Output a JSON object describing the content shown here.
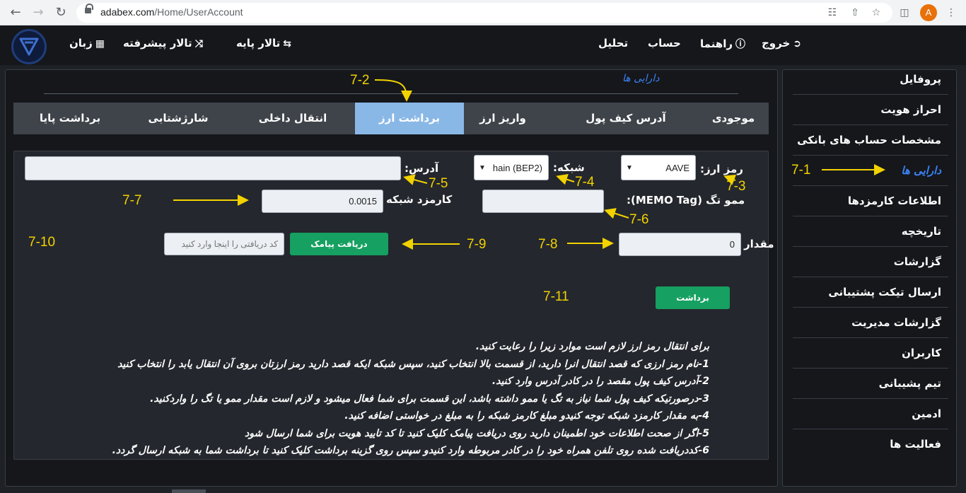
{
  "browser": {
    "url_host": "adabex.com",
    "url_path": "/Home/UserAccount",
    "profile_initial": "A",
    "icons": [
      "back-arrow-icon",
      "forward-arrow-icon",
      "reload-icon",
      "lock-icon",
      "translate-icon",
      "share-icon",
      "star-icon",
      "sidepanel-icon",
      "menu-dots-icon"
    ]
  },
  "topnav": {
    "exit": "خروج",
    "help": "راهنما",
    "account": "حساب",
    "analysis": "تحلیل",
    "basic_hall": "تالار پایه",
    "advanced_hall": "تالار پیشرفته",
    "language": "زبان"
  },
  "sidebar": {
    "items": [
      {
        "label": "پروفایل"
      },
      {
        "label": "احراز هویت"
      },
      {
        "label": "مشخصات حساب های بانکی"
      },
      {
        "label": "دارایی ها"
      },
      {
        "label": "اطلاعات کارمزدها"
      },
      {
        "label": "تاریخچه"
      },
      {
        "label": "گزارشات"
      },
      {
        "label": "ارسال تیکت پشتیبانی"
      },
      {
        "label": "گزارشات مدیریت"
      },
      {
        "label": "کاربران"
      },
      {
        "label": "تیم پشیبانی"
      },
      {
        "label": "ادمین"
      },
      {
        "label": "فعالیت ها"
      }
    ],
    "active": "دارایی ها"
  },
  "main": {
    "title": "دارایی ها",
    "tabs": [
      {
        "label": "موجودی"
      },
      {
        "label": "آدرس کیف پول"
      },
      {
        "label": "واریز ارز"
      },
      {
        "label": "برداشت ارز"
      },
      {
        "label": "انتقال داخلی"
      },
      {
        "label": "شارژشتابی"
      },
      {
        "label": "برداشت پایا"
      }
    ],
    "active_tab": "برداشت ارز"
  },
  "form": {
    "currency_label": "رمز ارز:",
    "currency_value": "AAVE",
    "network_label": "شبکه:",
    "network_value": "hain (BEP2)",
    "address_label": "آدرس:",
    "address_value": "",
    "memo_label": "ممو تگ (MEMO Tag):",
    "memo_value": "",
    "fee_label": "کارمزد شبکه",
    "fee_value": "0.0015",
    "amount_label": "مقدار",
    "amount_value": "0",
    "sms_button": "دریافت پیامک",
    "code_placeholder": "کد دریافتی را اینجا وارد کنید",
    "withdraw_button": "برداشت"
  },
  "annotations": [
    "7-1",
    "7-2",
    "7-3",
    "7-4",
    "7-5",
    "7-6",
    "7-7",
    "7-8",
    "7-9",
    "7-10",
    "7-11"
  ],
  "instructions": [
    "برای انتقال رمز ارز لازم است موارد زیرا را رعایت کنید.",
    "1-نام رمز ارزی که قصد انتقال انرا دارید، از قسمت بالا انتخاب کنید، سپس شبکه ایکه قصد دارید رمز ارزتان بروی آن انتقال یابد را انتخاب کنید",
    "2-آدرس کیف پول مقصد را در کادر آدرس وارد کنید.",
    "3-درصورتیکه کیف پول شما نیاز به تگ یا ممو داشته باشد، این قسمت برای شما فعال میشود و لازم است مقدار ممو یا تگ را واردکنید.",
    "4-به مقدار کارمزد شبکه توجه کنیدو مبلغ کارمز شبکه را به مبلغ در خواستی اضافه کنید.",
    "5-اگر از صحت اطلاعات خود اطمینان دارید روی دریافت پیامک کلیک کنید تا کد تایید هویت برای شما ارسال شود",
    "6-کددریافت شده روی تلفن همراه خود را در کادر مربوطه وارد کنیدو سپس روی گزینه برداشت کلیک کنید تا برداشت شما به شبکه ارسال گردد."
  ],
  "colors": {
    "accent_blue": "#3b82f6",
    "active_tab": "#8ab8e6",
    "green_button": "#16a061",
    "annotation_yellow": "#f2d200",
    "page_bg": "#1e2126"
  }
}
